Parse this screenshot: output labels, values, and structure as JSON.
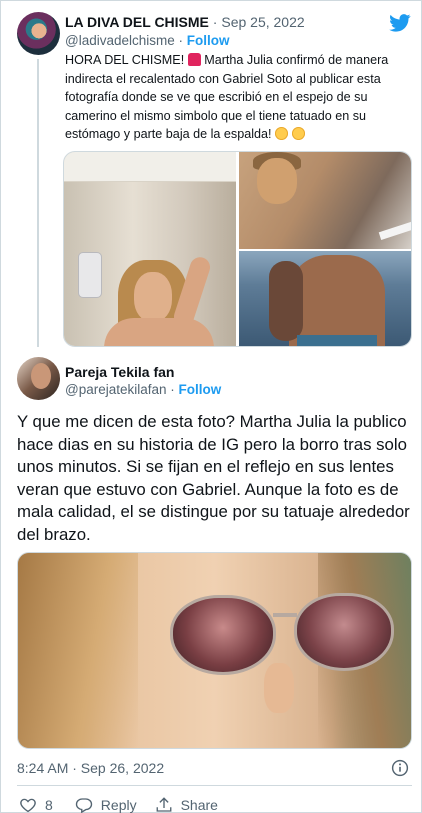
{
  "colors": {
    "accent": "#1d9bf0",
    "text": "#0f1419",
    "muted": "#536471",
    "border": "#cfd9de"
  },
  "parent_tweet": {
    "author_name": "LA DIVA DEL CHISME",
    "separator": " · ",
    "date": "Sep 25, 2022",
    "handle": "@ladivadelchisme",
    "handle_separator": " · ",
    "follow_label": "Follow",
    "text_part1": "HORA DEL CHISME! ",
    "emoji1": "rotating-light",
    "text_part2": " Martha Julia confirmó de manera indirecta el recalentado con Gabriel Soto al publicar esta fotografía donde se ve que escribió en el espejo de su camerino el mismo simbolo que el tiene tatuado en su estómago y parte baja de la espalda! ",
    "emoji2": "flushed-face",
    "emoji3": "shushing-face",
    "media_count": 3
  },
  "main_tweet": {
    "author_name": "Pareja Tekila fan",
    "handle": "@parejatekilafan",
    "handle_separator": " · ",
    "follow_label": "Follow",
    "text": "Y que me dicen de esta foto? Martha Julia la publico hace dias en su historia de IG pero la borro tras solo unos minutos. Si se fijan en el reflejo en sus lentes veran que estuvo con Gabriel. Aunque la foto es de mala calidad, el se distingue por su tatuaje alrededor del brazo.",
    "timestamp": "8:24 AM · Sep 26, 2022",
    "like_count": "8",
    "reply_label": "Reply",
    "share_label": "Share"
  },
  "icons": {
    "brand": "twitter-bird-icon",
    "info": "info-circle-icon",
    "like": "heart-icon",
    "reply": "speech-bubble-icon",
    "share": "share-upload-icon"
  }
}
